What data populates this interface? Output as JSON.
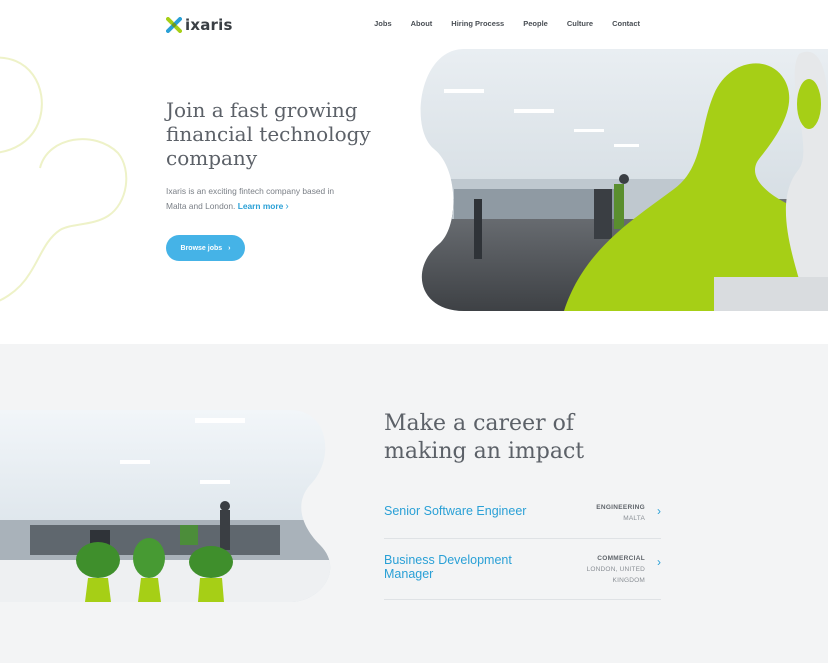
{
  "brand": {
    "name": "ixaris",
    "accent": "#2aa0d6",
    "button": "#45b3e7",
    "lime": "#a6cf16"
  },
  "nav": {
    "items": [
      "Jobs",
      "About",
      "Hiring Process",
      "People",
      "Culture",
      "Contact"
    ]
  },
  "hero": {
    "title": "Join a fast growing financial technology company",
    "description": "Ixaris is an exciting fintech company based in Malta and London.",
    "learn_more": "Learn more",
    "button_label": "Browse jobs"
  },
  "career": {
    "title": "Make a career of making an impact",
    "jobs": [
      {
        "title": "Senior Software Engineer",
        "department": "ENGINEERING",
        "location": "MALTA"
      },
      {
        "title": "Business Development Manager",
        "department": "COMMERCIAL",
        "location": "LONDON, UNITED KINGDOM"
      }
    ]
  },
  "icons": {
    "chevron": "chevron-right-icon",
    "logo": "ixaris-logo-icon"
  }
}
